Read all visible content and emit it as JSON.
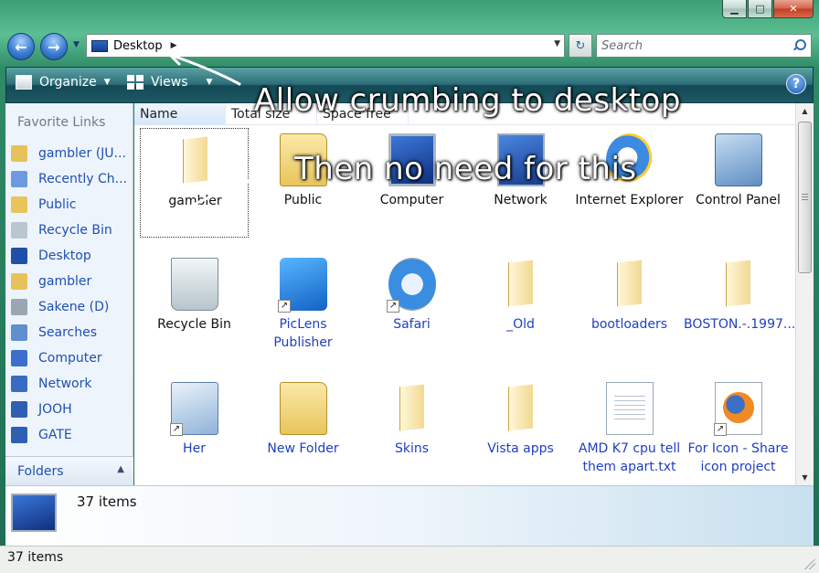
{
  "window": {
    "minimize_glyph": "▁",
    "maximize_glyph": "□",
    "close_glyph": "✕"
  },
  "nav": {
    "back_glyph": "←",
    "forward_glyph": "→",
    "recent_glyph": "▼",
    "address": "Desktop",
    "address_arrow": "▶",
    "address_dropdown": "▼",
    "refresh_glyph": "↻",
    "search_placeholder": "Search"
  },
  "toolbar": {
    "organize": "Organize",
    "views": "Views",
    "caret": "▼",
    "help": "?"
  },
  "sidebar": {
    "title": "Favorite Links",
    "items": [
      {
        "label": "gambler (JU...",
        "icon": "user-folder-icon",
        "color": "#e6c25a"
      },
      {
        "label": "Recently Ch...",
        "icon": "recent-icon",
        "color": "#6a9be0"
      },
      {
        "label": "Public",
        "icon": "folder-icon",
        "color": "#e8c55c"
      },
      {
        "label": "Recycle Bin",
        "icon": "recycle-bin-icon",
        "color": "#b9c7cf"
      },
      {
        "label": "Desktop",
        "icon": "desktop-icon",
        "color": "#1f4fa8"
      },
      {
        "label": "gambler",
        "icon": "user-folder-icon",
        "color": "#e6c25a"
      },
      {
        "label": "Sakene (D)",
        "icon": "drive-icon",
        "color": "#9aa7b3"
      },
      {
        "label": "Searches",
        "icon": "search-folder-icon",
        "color": "#5f8fcf"
      },
      {
        "label": "Computer",
        "icon": "computer-icon",
        "color": "#3b6fcb"
      },
      {
        "label": "Network",
        "icon": "network-icon",
        "color": "#3a6bc4"
      },
      {
        "label": "JOOH",
        "icon": "network-computer-icon",
        "color": "#2e5fb3"
      },
      {
        "label": "GATE",
        "icon": "network-computer-icon",
        "color": "#2e5fb3"
      }
    ],
    "folders": "Folders",
    "folders_caret": "▲"
  },
  "columns": [
    "Name",
    "Total size",
    "Space free"
  ],
  "items": [
    {
      "label": "gambler",
      "icon": "user-folder-icon",
      "kind": "folder-open",
      "blue": false,
      "shortcut": false,
      "selected": true
    },
    {
      "label": "Public",
      "icon": "folder-icon",
      "kind": "folder",
      "blue": false,
      "shortcut": false
    },
    {
      "label": "Computer",
      "icon": "computer-icon",
      "kind": "comp",
      "blue": false,
      "shortcut": false
    },
    {
      "label": "Network",
      "icon": "network-icon",
      "kind": "net",
      "blue": false,
      "shortcut": false
    },
    {
      "label": "Internet Explorer",
      "icon": "internet-explorer-icon",
      "kind": "ie",
      "blue": false,
      "shortcut": false
    },
    {
      "label": "Control Panel",
      "icon": "control-panel-icon",
      "kind": "cpanel",
      "blue": false,
      "shortcut": false
    },
    {
      "label": "Recycle Bin",
      "icon": "recycle-bin-icon",
      "kind": "recycle",
      "blue": false,
      "shortcut": false
    },
    {
      "label": "PicLens Publisher",
      "icon": "piclens-icon",
      "kind": "piclens",
      "blue": true,
      "shortcut": true
    },
    {
      "label": "Safari",
      "icon": "safari-icon",
      "kind": "safari",
      "blue": true,
      "shortcut": true
    },
    {
      "label": "_Old",
      "icon": "folder-icon",
      "kind": "folder-open",
      "blue": true,
      "shortcut": false
    },
    {
      "label": "bootloaders",
      "icon": "folder-icon",
      "kind": "folder-open",
      "blue": true,
      "shortcut": false
    },
    {
      "label": "BOSTON.-.1997....",
      "icon": "folder-icon",
      "kind": "folder-open",
      "blue": true,
      "shortcut": false
    },
    {
      "label": "Her",
      "icon": "network-shortcut-icon",
      "kind": "network2",
      "blue": true,
      "shortcut": true
    },
    {
      "label": "New Folder",
      "icon": "folder-icon",
      "kind": "folder",
      "blue": true,
      "shortcut": false
    },
    {
      "label": "Skins",
      "icon": "folder-icon",
      "kind": "folder-open",
      "blue": true,
      "shortcut": false
    },
    {
      "label": "Vista apps",
      "icon": "folder-icon",
      "kind": "folder-open",
      "blue": true,
      "shortcut": false
    },
    {
      "label": "AMD K7 cpu tell them apart.txt",
      "icon": "text-document-icon",
      "kind": "doc",
      "blue": true,
      "shortcut": false
    },
    {
      "label": "For Icon - Share icon project",
      "icon": "firefox-shortcut-icon",
      "kind": "ff",
      "blue": true,
      "shortcut": true
    }
  ],
  "scrollbar": {
    "up": "▲",
    "down": "▼"
  },
  "details": {
    "count": "37 items"
  },
  "status": {
    "count": "37 items"
  },
  "annotations": {
    "line1": "Allow crumbing to desktop",
    "line2": "Then no need for this"
  }
}
